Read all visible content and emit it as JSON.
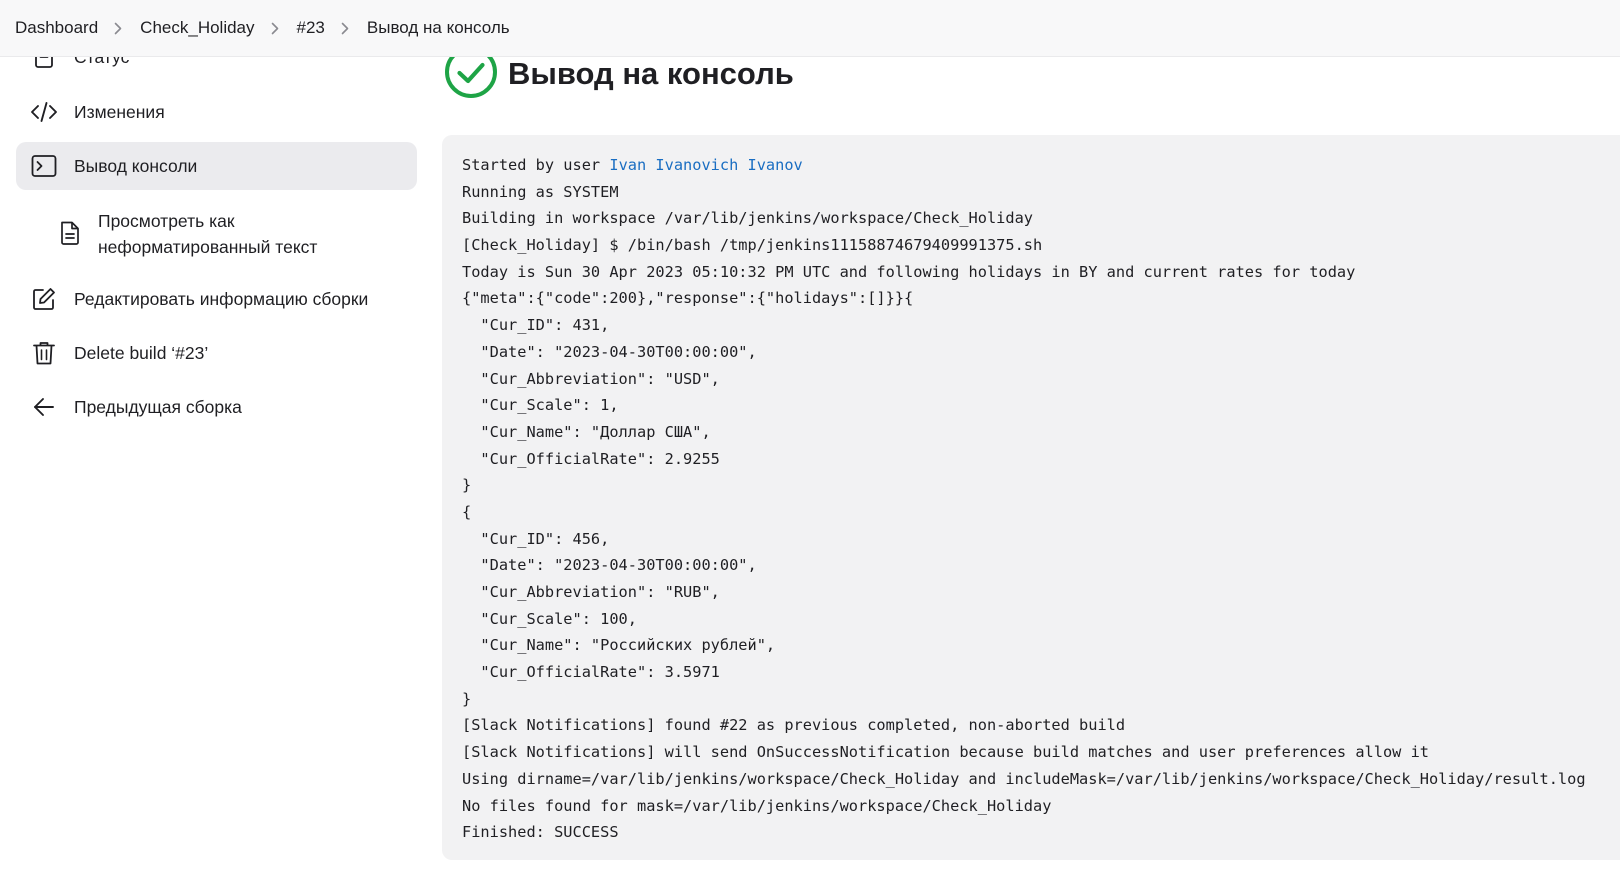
{
  "breadcrumb": {
    "items": [
      "Dashboard",
      "Check_Holiday",
      "#23",
      "Вывод на консоль"
    ]
  },
  "sidebar": {
    "items": [
      {
        "label": "Статус",
        "icon": "status-icon"
      },
      {
        "label": "Изменения",
        "icon": "code-icon"
      },
      {
        "label": "Вывод консоли",
        "icon": "terminal-icon",
        "active": true
      },
      {
        "label": "Просмотреть как неформатированный текст",
        "icon": "document-icon",
        "sub": true
      },
      {
        "label": "Редактировать информацию сборки",
        "icon": "edit-icon"
      },
      {
        "label": "Delete build ‘#23’",
        "icon": "trash-icon"
      },
      {
        "label": "Предыдущая сборка",
        "icon": "arrow-left-icon"
      }
    ]
  },
  "main": {
    "title": "Вывод на консоль",
    "status_icon": "success-check-icon",
    "status_color": "#1ea446"
  },
  "console": {
    "started_prefix": "Started by user ",
    "started_user": "Ivan Ivanovich Ivanov",
    "lines": [
      "Running as SYSTEM",
      "Building in workspace /var/lib/jenkins/workspace/Check_Holiday",
      "[Check_Holiday] $ /bin/bash /tmp/jenkins11158874679409991375.sh",
      "Today is Sun 30 Apr 2023 05:10:32 PM UTC and following holidays in BY and current rates for today",
      "{\"meta\":{\"code\":200},\"response\":{\"holidays\":[]}}{",
      "  \"Cur_ID\": 431,",
      "  \"Date\": \"2023-04-30T00:00:00\",",
      "  \"Cur_Abbreviation\": \"USD\",",
      "  \"Cur_Scale\": 1,",
      "  \"Cur_Name\": \"Доллар США\",",
      "  \"Cur_OfficialRate\": 2.9255",
      "}",
      "{",
      "  \"Cur_ID\": 456,",
      "  \"Date\": \"2023-04-30T00:00:00\",",
      "  \"Cur_Abbreviation\": \"RUB\",",
      "  \"Cur_Scale\": 100,",
      "  \"Cur_Name\": \"Российских рублей\",",
      "  \"Cur_OfficialRate\": 3.5971",
      "}",
      "[Slack Notifications] found #22 as previous completed, non-aborted build",
      "[Slack Notifications] will send OnSuccessNotification because build matches and user preferences allow it",
      "Using dirname=/var/lib/jenkins/workspace/Check_Holiday and includeMask=/var/lib/jenkins/workspace/Check_Holiday/result.log",
      "No files found for mask=/var/lib/jenkins/workspace/Check_Holiday",
      "Finished: SUCCESS"
    ]
  }
}
